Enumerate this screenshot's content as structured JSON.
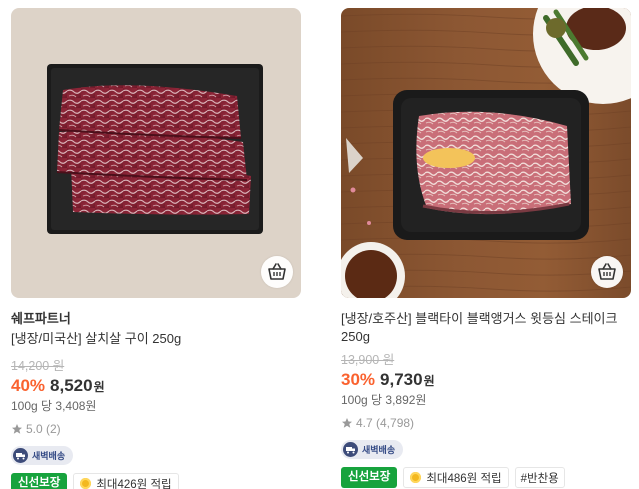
{
  "products": [
    {
      "brand": "쉐프파트너",
      "name": "[냉장/미국산] 살치살 구이 250g",
      "original_price": "14,200 원",
      "discount_rate": "40%",
      "price": "8,520",
      "currency": "원",
      "unit_price": "100g 당 3,408원",
      "rating": "5.0 (2)",
      "delivery_badge": "새벽배송",
      "fresh_badge": "신선보장",
      "points_badge": "최대426원 적립",
      "hashtag": "",
      "image_icon": "beef-tray-image",
      "cart_icon": "basket-icon"
    },
    {
      "brand": "",
      "name": "[냉장/호주산] 블랙타이 블랙앵거스 윗등심 스테이크 250g",
      "original_price": "13,900 원",
      "discount_rate": "30%",
      "price": "9,730",
      "currency": "원",
      "unit_price": "100g 당 3,892원",
      "rating": "4.7 (4,798)",
      "delivery_badge": "새벽배송",
      "fresh_badge": "신선보장",
      "points_badge": "최대486원 적립",
      "hashtag": "#반찬용",
      "image_icon": "steak-tray-image",
      "cart_icon": "basket-icon"
    }
  ],
  "colors": {
    "discount": "#fa622f",
    "fresh_badge": "#17a33d",
    "dawn_badge_text": "#354b86",
    "coin": "#f3b81f"
  }
}
